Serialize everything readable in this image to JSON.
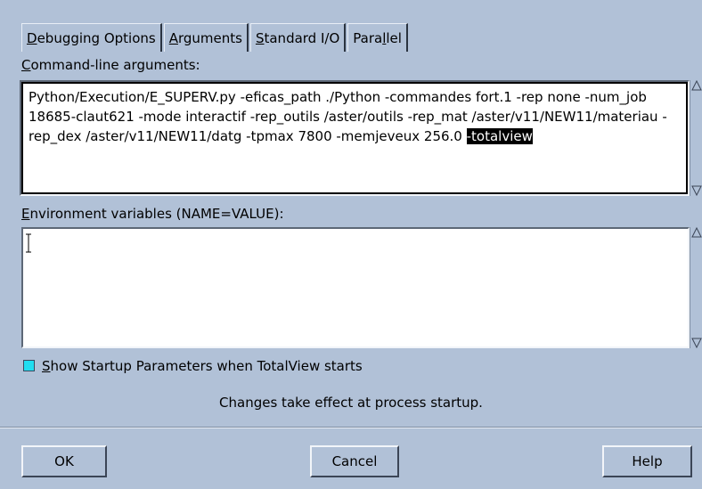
{
  "tabs": {
    "debugging_options": {
      "before": "",
      "ul": "D",
      "after": "ebugging Options"
    },
    "arguments": {
      "before": "",
      "ul": "A",
      "after": "rguments"
    },
    "standard_io": {
      "before": "",
      "ul": "S",
      "after": "tandard I/O"
    },
    "parallel": {
      "before": "Para",
      "ul": "l",
      "after": "lel"
    }
  },
  "cmdline": {
    "label_ul": "C",
    "label_rest": "ommand-line arguments:",
    "text": "Python/Execution/E_SUPERV.py -eficas_path ./Python -commandes fort.1 -rep none -num_job 18685-claut621 -mode interactif -rep_outils /aster/outils -rep_mat /aster/v11/NEW11/materiau -rep_dex /aster/v11/NEW11/datg -tpmax 7800 -memjeveux 256.0 ",
    "selected": "-totalview"
  },
  "env": {
    "label_ul": "E",
    "label_rest": "nvironment variables (NAME=VALUE):",
    "value": ""
  },
  "startup": {
    "checkbox_ul": "S",
    "checkbox_rest": "how Startup Parameters when TotalView starts",
    "checked": true,
    "note": "Changes take effect at process startup."
  },
  "buttons": {
    "ok": "OK",
    "cancel": "Cancel",
    "help": "Help"
  },
  "colors": {
    "background": "#b1c1d7",
    "checkbox": "#21ddf0",
    "selection": "#000000"
  }
}
